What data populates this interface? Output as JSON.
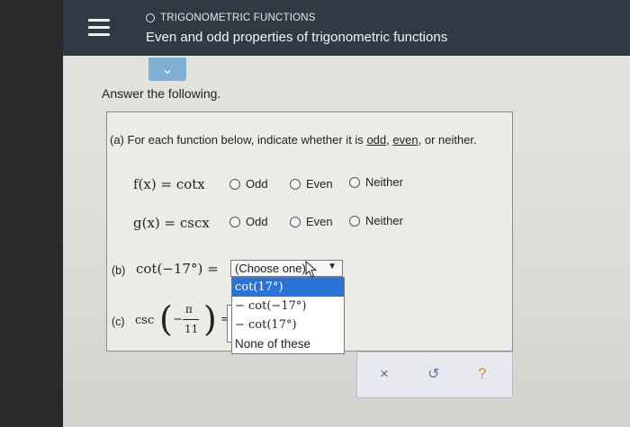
{
  "header": {
    "topic": "TRIGONOMETRIC FUNCTIONS",
    "title": "Even and odd properties of trigonometric functions"
  },
  "prompt": "Answer the following.",
  "part_a": {
    "label": "(a) For each function below, indicate whether it is",
    "odd_word": "odd",
    "even_word": "even",
    "tail": "or neither.",
    "comma1": ",",
    "comma2": ",",
    "rows": [
      {
        "function": "f(x) = cotx",
        "options": [
          "Odd",
          "Even",
          "Neither"
        ]
      },
      {
        "function": "g(x) = cscx",
        "options": [
          "Odd",
          "Even",
          "Neither"
        ]
      }
    ]
  },
  "part_b": {
    "label": "(b)",
    "expression": "cot(−17°) =",
    "select_value": "(Choose one)",
    "dropdown_options": [
      "cot(17°)",
      "− cot(−17°)",
      "− cot(17°)",
      "None of these"
    ]
  },
  "part_c": {
    "label": "(c)",
    "func": "csc",
    "minus": "−",
    "numerator": "π",
    "denominator": "11",
    "equals": "="
  },
  "actions": {
    "close": "×",
    "undo": "↺",
    "help": "?"
  }
}
